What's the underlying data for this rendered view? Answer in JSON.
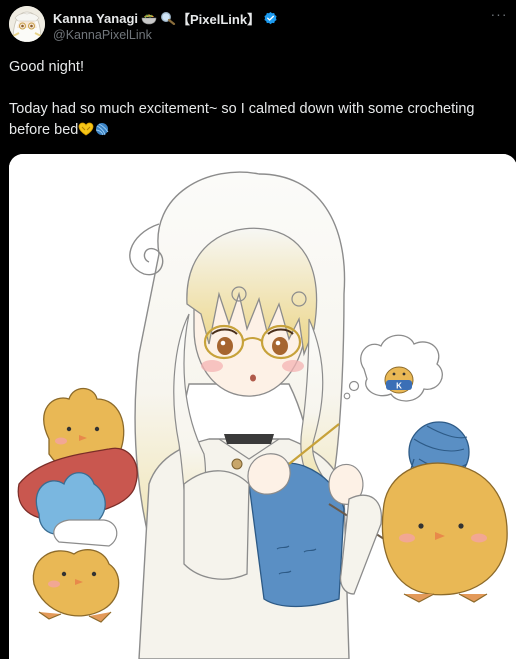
{
  "author": {
    "display_name": "Kanna Yanagi",
    "tag": "【PixelLink】",
    "handle": "@KannaPixelLink",
    "name_emoji_icons": [
      "bowl-icon",
      "magnifier-icon"
    ],
    "verified": true,
    "verified_color": "#1d9bf0"
  },
  "post": {
    "line1": "Good night!",
    "line2": "Today had so much excitement~ so I calmed down with some crocheting",
    "line3": "before bed",
    "trailing_emoji_icons": [
      "yellow-heart-hands-icon",
      "yarn-ball-icon"
    ]
  },
  "more_label": "···",
  "colors": {
    "background": "#000000",
    "text": "#e7e9ea",
    "secondary_text": "#71767b",
    "media_background": "#ffffff",
    "yarn_blue": "#5a8fc4",
    "chick_yellow": "#e9b855"
  }
}
